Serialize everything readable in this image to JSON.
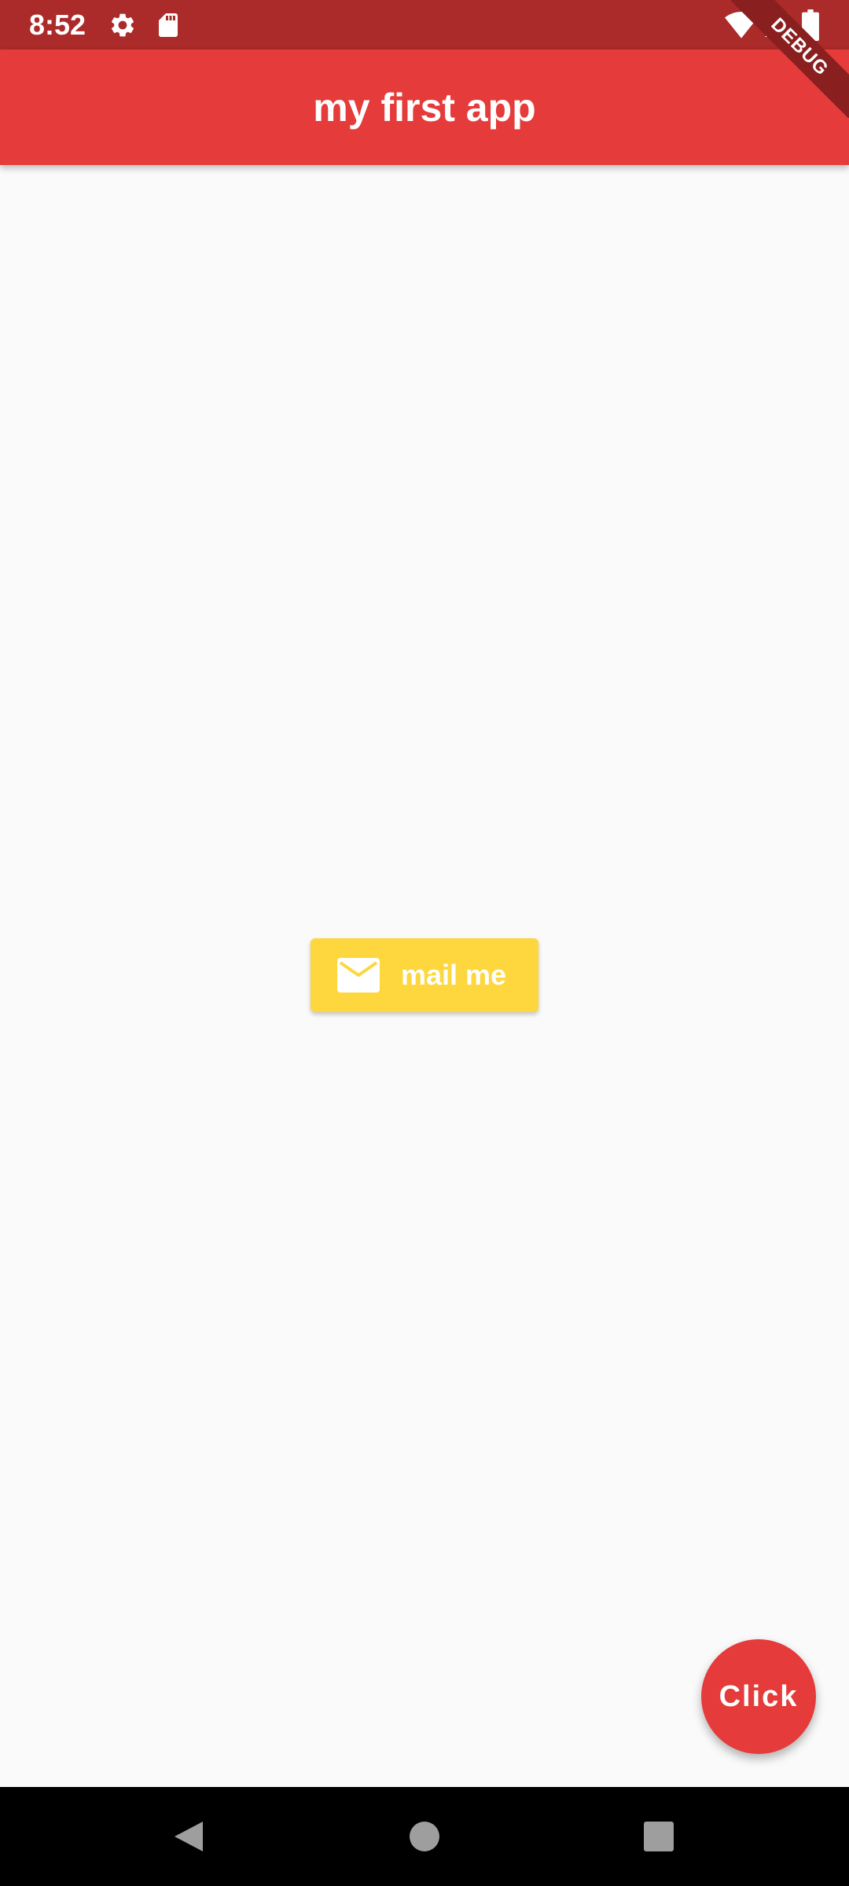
{
  "status_bar": {
    "time": "8:52",
    "icons": [
      "settings-icon",
      "sd-card-icon",
      "wifi-icon",
      "cell-signal-icon",
      "battery-icon"
    ]
  },
  "app_bar": {
    "title": "my first app"
  },
  "debug_banner": {
    "label": "DEBUG"
  },
  "mail_button": {
    "label": "mail me",
    "icon": "mail-icon"
  },
  "fab": {
    "label": "Click"
  },
  "navigation_bar": {
    "buttons": [
      "back-icon",
      "home-icon",
      "recents-icon"
    ]
  },
  "colors": {
    "status_bar": "#ab2a2a",
    "app_bar": "#e53b3a",
    "mail_button": "#fdd73d",
    "fab": "#e53b3a",
    "background": "#fafafa"
  }
}
